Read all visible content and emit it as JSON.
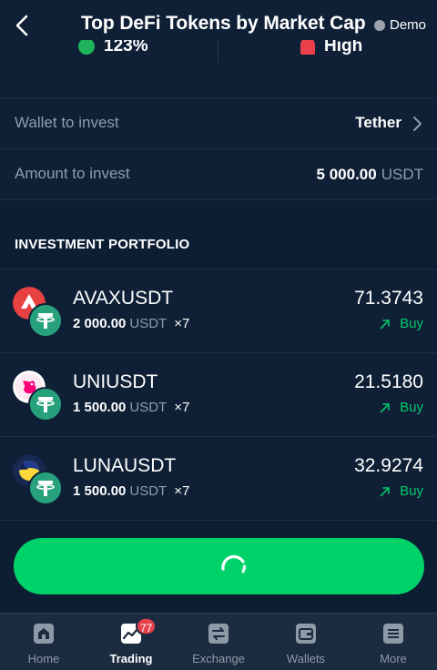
{
  "header": {
    "title": "Top DeFi Tokens by Market Cap",
    "mode_label": "Demo"
  },
  "stats": {
    "left_value": "123%",
    "right_value": "High"
  },
  "wallet": {
    "label": "Wallet to invest",
    "value": "Tether"
  },
  "amount": {
    "label": "Amount to invest",
    "value": "5 000.00",
    "unit": "USDT"
  },
  "portfolio": {
    "title": "INVESTMENT PORTFOLIO",
    "items": [
      {
        "pair": "AVAXUSDT",
        "amount": "2 000.00",
        "unit": "USDT",
        "leverage": "×7",
        "price": "71.3743",
        "action": "Buy",
        "coin_icon": "avax-icon"
      },
      {
        "pair": "UNIUSDT",
        "amount": "1 500.00",
        "unit": "USDT",
        "leverage": "×7",
        "price": "21.5180",
        "action": "Buy",
        "coin_icon": "uniswap-icon"
      },
      {
        "pair": "LUNAUSDT",
        "amount": "1 500.00",
        "unit": "USDT",
        "leverage": "×7",
        "price": "32.9274",
        "action": "Buy",
        "coin_icon": "luna-icon"
      }
    ]
  },
  "cta": {
    "state": "loading"
  },
  "tabbar": {
    "tabs": [
      {
        "label": "Home",
        "icon": "home-icon"
      },
      {
        "label": "Trading",
        "icon": "chart-icon",
        "badge": "77",
        "active": true
      },
      {
        "label": "Exchange",
        "icon": "exchange-icon"
      },
      {
        "label": "Wallets",
        "icon": "wallet-icon"
      },
      {
        "label": "More",
        "icon": "menu-icon"
      }
    ]
  },
  "colors": {
    "background": "#0d1e33",
    "accent_green": "#00d26a",
    "buy_green": "#00c76d",
    "badge_red": "#e8414b",
    "muted_text": "#8d9db1"
  }
}
